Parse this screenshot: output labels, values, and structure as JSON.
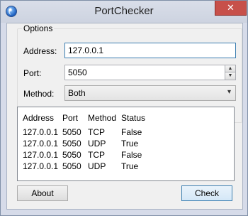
{
  "window": {
    "title": "PortChecker",
    "close_label": "✕"
  },
  "options": {
    "group_label": "Options",
    "address_label": "Address:",
    "address_value": "127.0.0.1",
    "port_label": "Port:",
    "port_value": "5050",
    "method_label": "Method:",
    "method_value": "Both"
  },
  "results": {
    "columns": [
      "Address",
      "Port",
      "Method",
      "Status"
    ],
    "rows": [
      [
        "127.0.0.1",
        "5050",
        "TCP",
        "False"
      ],
      [
        "127.0.0.1",
        "5050",
        "UDP",
        "True"
      ],
      [
        "127.0.0.1",
        "5050",
        "TCP",
        "False"
      ],
      [
        "127.0.0.1",
        "5050",
        "UDP",
        "True"
      ]
    ]
  },
  "buttons": {
    "about": "About",
    "check": "Check"
  },
  "icons": {
    "app": "globe-icon",
    "spin_up": "▲",
    "spin_down": "▼",
    "dropdown": "▾"
  }
}
